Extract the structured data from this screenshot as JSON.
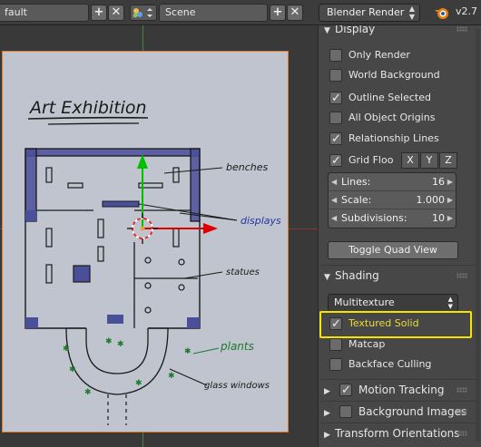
{
  "header": {
    "layout_name": "fault",
    "scene_name": "Scene",
    "add_symbol": "+",
    "close_symbol": "✕",
    "render_engine": "Blender Render",
    "version": "v2.7",
    "scene_icon": "scene-icon",
    "blender_icon": "blender-logo-icon"
  },
  "drawing": {
    "title": "Art Exhibition",
    "labels": {
      "benches": "benches",
      "displays": "displays",
      "statues": "statues",
      "plants": "plants",
      "glass_windows": "glass windows"
    },
    "colors": {
      "ink": "#1a1a1a",
      "displays_ink": "#2233aa",
      "plants_ink": "#1d7a2b",
      "hatch": "#4a4f9a"
    }
  },
  "viewport": {
    "border_color": "#e07b21",
    "y_axis_color": "#00c000",
    "x_axis_color": "#e00000"
  },
  "panel": {
    "display": {
      "header": "Display",
      "only_render": {
        "label": "Only Render",
        "checked": false
      },
      "world_background": {
        "label": "World Background",
        "checked": false
      },
      "outline_selected": {
        "label": "Outline Selected",
        "checked": true
      },
      "all_object_origins": {
        "label": "All Object Origins",
        "checked": false
      },
      "relationship_lines": {
        "label": "Relationship Lines",
        "checked": true
      },
      "grid_floor": {
        "label": "Grid Floo",
        "checked": true
      },
      "axes": [
        "X",
        "Y",
        "Z"
      ],
      "lines": {
        "label": "Lines:",
        "value": "16"
      },
      "scale": {
        "label": "Scale:",
        "value": "1.000"
      },
      "subdivisions": {
        "label": "Subdivisions:",
        "value": "10"
      },
      "toggle_quad_view": "Toggle Quad View"
    },
    "shading": {
      "header": "Shading",
      "mode": "Multitexture",
      "textured_solid": {
        "label": "Textured Solid",
        "checked": true
      },
      "matcap": {
        "label": "Matcap",
        "checked": false
      },
      "backface_culling": {
        "label": "Backface Culling",
        "checked": false
      }
    },
    "motion_tracking": {
      "label": "Motion Tracking",
      "checked": true
    },
    "background_images": "Background Images",
    "transform_orientations": "Transform Orientations",
    "highlight_color": "#f4e400"
  }
}
